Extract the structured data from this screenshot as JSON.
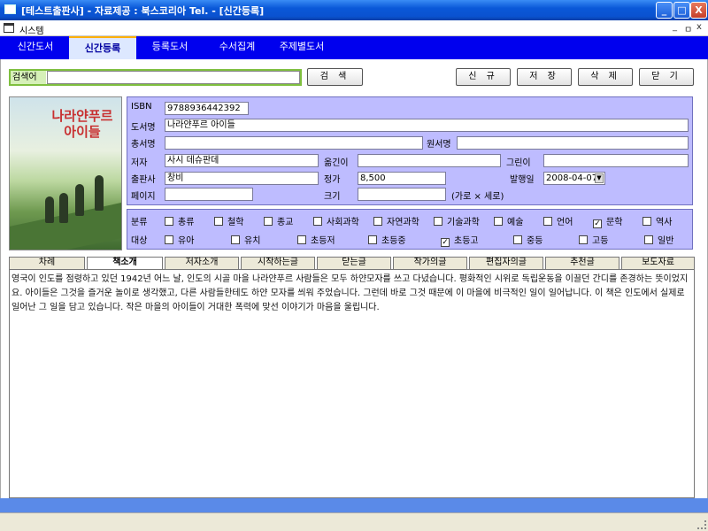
{
  "window": {
    "title": "[테스트출판사] - 자료제공 : 북스코리아  Tel. - [신간등록]",
    "minimize": "_",
    "restore": "□",
    "close": "X"
  },
  "menubar": {
    "label": "시스템",
    "ctl_min": "_",
    "ctl_restore": "ㅁ",
    "ctl_close": "x"
  },
  "tabs": [
    "신간도서",
    "신간등록",
    "등록도서",
    "수서집계",
    "주제별도서"
  ],
  "active_tab": "신간등록",
  "search": {
    "label": "검색어",
    "value": "",
    "button": "검 색"
  },
  "toolbar": {
    "new": "신 규",
    "save": "저 장",
    "delete": "삭 제",
    "close": "닫 기"
  },
  "cover": {
    "title_text": "나라얀푸르 아이들"
  },
  "form": {
    "isbn_label": "ISBN",
    "isbn": "9788936442392",
    "title_label": "도서명",
    "title": "나라얀푸르 아이들",
    "series_label": "총서명",
    "series": "",
    "original_label": "원서명",
    "original": "",
    "author_label": "저자",
    "author": "사시 데슈판데",
    "translator_label": "옮긴이",
    "translator": "",
    "illustrator_label": "그린이",
    "illustrator": "",
    "publisher_label": "출판사",
    "publisher": "창비",
    "price_label": "정가",
    "price": "8,500",
    "pubdate_label": "발행일",
    "pubdate": "2008-04-07",
    "pages_label": "페이지",
    "pages": "",
    "size_label": "크기",
    "size": "",
    "size_hint": "(가로 × 세로)"
  },
  "categories": {
    "label": "분류",
    "items": [
      {
        "label": "총류",
        "checked": false
      },
      {
        "label": "철학",
        "checked": false
      },
      {
        "label": "종교",
        "checked": false
      },
      {
        "label": "사회과학",
        "checked": false
      },
      {
        "label": "자연과학",
        "checked": false
      },
      {
        "label": "기술과학",
        "checked": false
      },
      {
        "label": "예술",
        "checked": false
      },
      {
        "label": "언어",
        "checked": false
      },
      {
        "label": "문학",
        "checked": true
      },
      {
        "label": "역사",
        "checked": false
      }
    ]
  },
  "audience": {
    "label": "대상",
    "items": [
      {
        "label": "유아",
        "checked": false
      },
      {
        "label": "유치",
        "checked": false
      },
      {
        "label": "초등저",
        "checked": false
      },
      {
        "label": "초등중",
        "checked": false
      },
      {
        "label": "초등고",
        "checked": true
      },
      {
        "label": "중등",
        "checked": false
      },
      {
        "label": "고등",
        "checked": false
      },
      {
        "label": "일반",
        "checked": false
      }
    ]
  },
  "subtabs": [
    "차례",
    "책소개",
    "저자소개",
    "시작하는글",
    "닫는글",
    "작가의글",
    "편집자의글",
    "추천글",
    "보도자료"
  ],
  "active_subtab": "책소개",
  "description": "영국이 인도를 점령하고 있던 1942년 어느 날, 인도의 시골 마을 나라얀푸르 사람들은 모두 하얀모자를 쓰고 다녔습니다. 평화적인 시위로 독립운동을 이끌던 간디를 존경하는 뜻이었지요. 아이들은 그것을 즐거운 놀이로 생각했고, 다른 사람들한테도 하얀 모자를 씌워 주었습니다. 그런데 바로 그것 때문에 이 마을에 비극적인 일이 일어납니다. 이 책은 인도에서 실제로 일어난 그 일을 담고 있습니다. 작은 마을의 아이들이 거대한 폭력에 맞선 이야기가 마음을 울립니다."
}
